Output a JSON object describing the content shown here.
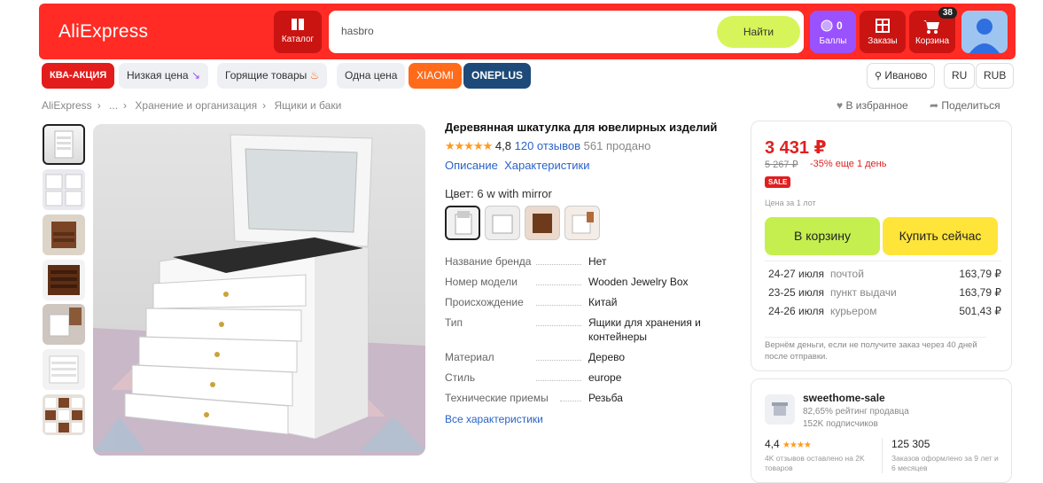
{
  "header": {
    "logo": "AliExpress",
    "catalog_label": "Каталог",
    "search_value": "hasbro",
    "search_button": "Найти",
    "points_count": "0",
    "points_label": "Баллы",
    "orders_label": "Заказы",
    "cart_label": "Корзина",
    "cart_badge": "38"
  },
  "promos": [
    "КВА-АКЦИЯ",
    "Низкая цена",
    "Горящие товары",
    "Одна цена",
    "XIAOMI",
    "ONEPLUS"
  ],
  "locale": {
    "city": "Иваново",
    "lang": "RU",
    "currency": "RUB"
  },
  "breadcrumb": [
    "AliExpress",
    "...",
    "Хранение и организация",
    "Ящики и баки"
  ],
  "actions": {
    "favorite": "В избранное",
    "share": "Поделиться"
  },
  "product": {
    "title": "Деревянная шкатулка для ювелирных изделий",
    "stars": "★★★★★",
    "rating": "4,8",
    "reviews": "120 отзывов",
    "sold": "561 продано",
    "tab_description": "Описание",
    "tab_specs": "Характеристики",
    "color_label": "Цвет: 6 w with mirror",
    "specs": [
      {
        "k": "Название бренда",
        "v": "Нет"
      },
      {
        "k": "Номер модели",
        "v": "Wooden Jewelry Box"
      },
      {
        "k": "Происхождение",
        "v": "Китай"
      },
      {
        "k": "Тип",
        "v": "Ящики для хранения и контейнеры"
      },
      {
        "k": "Материал",
        "v": "Дерево"
      },
      {
        "k": "Стиль",
        "v": "europe"
      },
      {
        "k": "Технические приемы",
        "v": "Резьба"
      }
    ],
    "all_specs": "Все характеристики"
  },
  "buy": {
    "price": "3 431 ₽",
    "old_price": "5 267 ₽",
    "discount": "-35% еще 1 день",
    "sale_badge": "SALE",
    "per_lot": "Цена за 1 лот",
    "cart_button": "В корзину",
    "buy_button": "Купить сейчас",
    "delivery": [
      {
        "date": "24-27 июля",
        "method": "почтой",
        "price": "163,79 ₽"
      },
      {
        "date": "23-25 июля",
        "method": "пункт выдачи",
        "price": "163,79 ₽"
      },
      {
        "date": "24-26 июля",
        "method": "курьером",
        "price": "501,43 ₽"
      }
    ],
    "refund": "Вернём деньги, если не получите заказ через 40 дней после отправки."
  },
  "seller": {
    "name": "sweethome-sale",
    "rating": "82,65% рейтинг продавца",
    "subscribers": "152K подписчиков",
    "score": "4,4",
    "score_stars": "★★★★",
    "orders": "125 305",
    "score_note": "4K отзывов оставлено на 2K товаров",
    "orders_note": "Заказов оформлено за 9 лет и 6 месяцев"
  },
  "colors": {
    "brand_red": "#ff2b24",
    "price_red": "#e01f1f",
    "cart_green": "#c5ef4f",
    "buy_yellow": "#ffe43a",
    "link_blue": "#2a63c8"
  }
}
